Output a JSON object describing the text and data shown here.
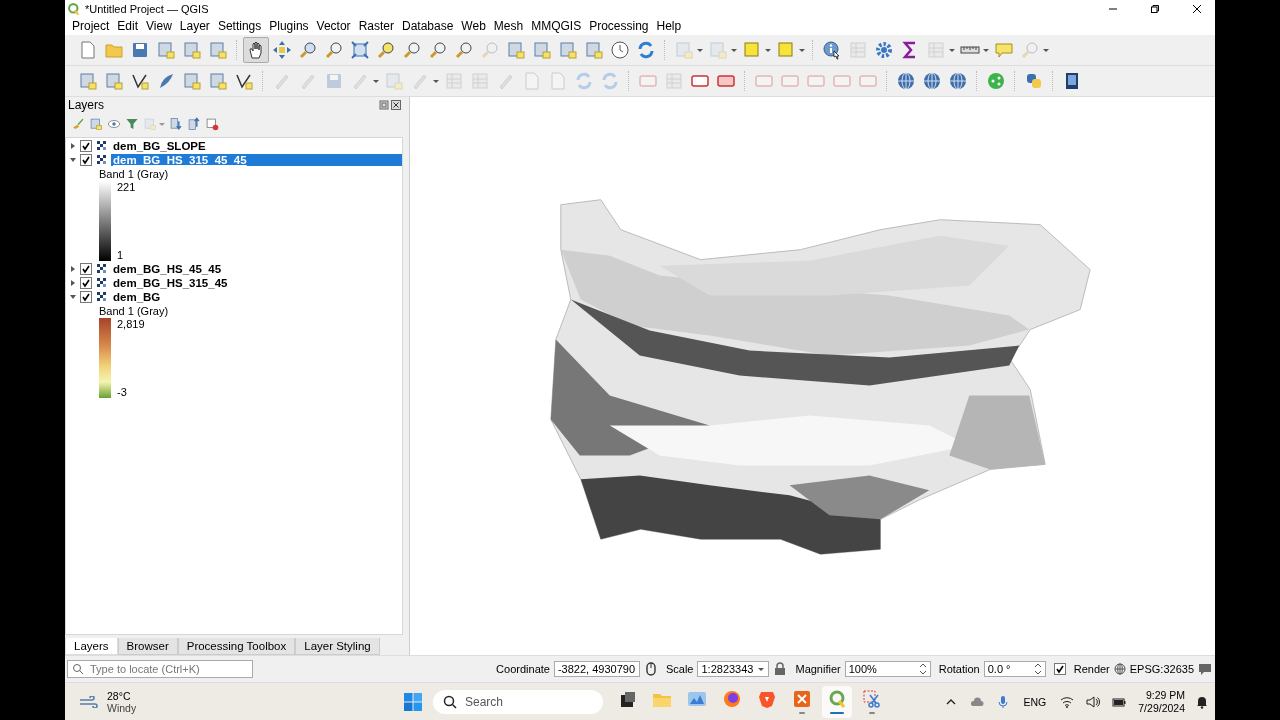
{
  "window": {
    "title": "*Untitled Project — QGIS"
  },
  "menu": [
    "Project",
    "Edit",
    "View",
    "Layer",
    "Settings",
    "Plugins",
    "Vector",
    "Raster",
    "Database",
    "Web",
    "Mesh",
    "MMQGIS",
    "Processing",
    "Help"
  ],
  "map_navigation": {
    "pan_tool_selected": true
  },
  "layers_panel": {
    "title": "Layers",
    "layers": [
      {
        "name": "dem_BG_SLOPE",
        "checked": true,
        "expanded": false,
        "selected": false
      },
      {
        "name": "dem_BG_HS_315_45_45",
        "checked": true,
        "expanded": true,
        "selected": true,
        "legend": {
          "band": "Band 1 (Gray)",
          "max": "221",
          "min": "1",
          "kind": "gray"
        }
      },
      {
        "name": "dem_BG_HS_45_45",
        "checked": true,
        "expanded": false,
        "selected": false
      },
      {
        "name": "dem_BG_HS_315_45",
        "checked": true,
        "expanded": false,
        "selected": false
      },
      {
        "name": "dem_BG",
        "checked": true,
        "expanded": true,
        "selected": false,
        "legend": {
          "band": "Band 1 (Gray)",
          "max": "2,819",
          "min": "-3",
          "kind": "elevation"
        }
      }
    ]
  },
  "panel_tabs": [
    {
      "label": "Layers",
      "selected": true
    },
    {
      "label": "Browser",
      "selected": false
    },
    {
      "label": "Processing Toolbox",
      "selected": false
    },
    {
      "label": "Layer Styling",
      "selected": false
    }
  ],
  "locator": {
    "placeholder": "Type to locate (Ctrl+K)"
  },
  "status_bar": {
    "coordinate_label": "Coordinate",
    "coordinate": "-3822, 4930790",
    "scale_label": "Scale",
    "scale": "1:2823343",
    "magnifier_label": "Magnifier",
    "magnifier": "100%",
    "rotation_label": "Rotation",
    "rotation": "0.0 °",
    "render_label": "Render",
    "render_checked": true,
    "crs": "EPSG:32635"
  },
  "taskbar": {
    "temperature": "28°C",
    "weather": "Windy",
    "search_placeholder": "Search",
    "apps": [
      {
        "kind": "files",
        "running": false,
        "selected": false
      },
      {
        "kind": "folder",
        "running": false,
        "selected": false
      },
      {
        "kind": "photos",
        "running": false,
        "selected": false
      },
      {
        "kind": "browser",
        "running": false,
        "selected": false
      },
      {
        "kind": "shield",
        "running": false,
        "selected": false
      },
      {
        "kind": "reader",
        "running": true,
        "selected": false
      },
      {
        "kind": "qgis",
        "running": true,
        "selected": true
      },
      {
        "kind": "snip",
        "running": true,
        "selected": false
      }
    ],
    "language": "ENG",
    "time": "9:29 PM",
    "date": "7/29/2024"
  }
}
